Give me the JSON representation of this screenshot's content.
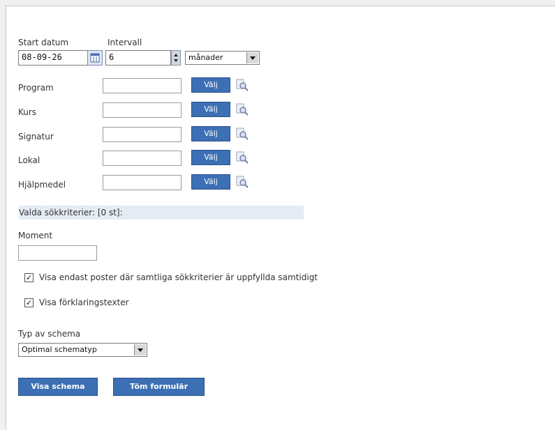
{
  "form": {
    "start_label": "Start datum",
    "start_value": "08-09-26",
    "interval_label": "Intervall",
    "interval_value": "6",
    "unit_selected": "månader",
    "fields": [
      {
        "label": "Program",
        "button": "Välj"
      },
      {
        "label": "Kurs",
        "button": "Välj"
      },
      {
        "label": "Signatur",
        "button": "Välj"
      },
      {
        "label": "Lokal",
        "button": "Välj"
      },
      {
        "label": "Hjälpmedel",
        "button": "Välj"
      }
    ],
    "selected_criteria": "Valda sökkriterier: [0 st]:",
    "moment_label": "Moment",
    "moment_value": "",
    "checkbox_all": "Visa endast poster där samtliga sökkriterier är uppfyllda samtidigt",
    "checkbox_explain": "Visa förklaringstexter",
    "schema_label": "Typ av schema",
    "schema_selected": "Optimal schematyp",
    "show_button": "Visa schema",
    "clear_button": "Töm formulär"
  }
}
